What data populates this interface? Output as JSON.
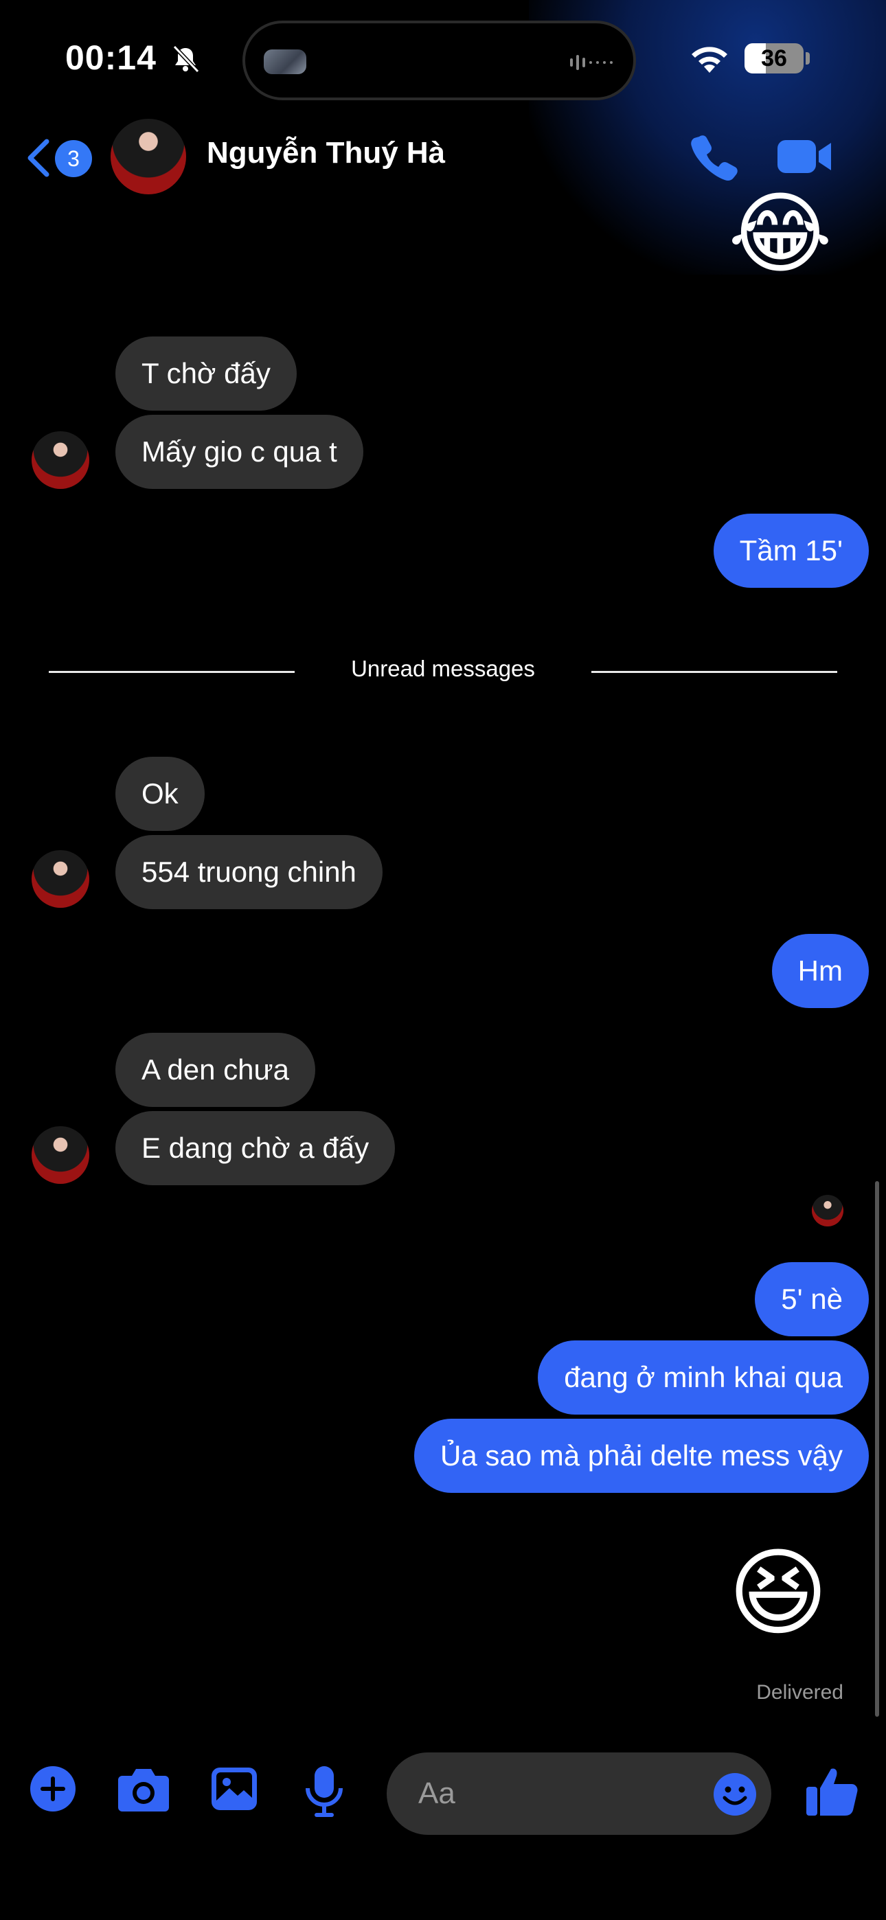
{
  "status_bar": {
    "time": "00:14",
    "battery_level": "36",
    "battery_fraction": 0.36,
    "icons": [
      "bell-slash-icon",
      "wifi-icon",
      "battery-icon"
    ]
  },
  "header": {
    "back_badge_count": "3",
    "contact_name": "Nguyễn Thuý Hà",
    "icons": [
      "chevron-left-icon",
      "phone-icon",
      "video-camera-icon"
    ],
    "accent_color": "#3478f6"
  },
  "conversation": {
    "top_emoji": "😂",
    "messages_1": [
      "T chờ đấy",
      "Mấy gio c qua t"
    ],
    "reply_1": "Tầm 15'",
    "unread_label": "Unread messages",
    "messages_2": [
      "Ok",
      "554 truong chinh"
    ],
    "reply_2": "Hm",
    "messages_3": [
      "A den chưa",
      "E dang chờ a đấy"
    ],
    "replies_3": [
      "5' nè",
      "đang ở minh khai qua",
      "Ủa sao mà phải delte mess vậy"
    ],
    "bottom_emoji": "😆",
    "status": "Delivered",
    "incoming_color": "#303030",
    "outgoing_color": "#3264f5"
  },
  "composer": {
    "placeholder": "Aa",
    "icons": [
      "plus-circle-icon",
      "camera-icon",
      "image-icon",
      "microphone-icon",
      "smiley-icon",
      "thumbs-up-icon"
    ]
  }
}
